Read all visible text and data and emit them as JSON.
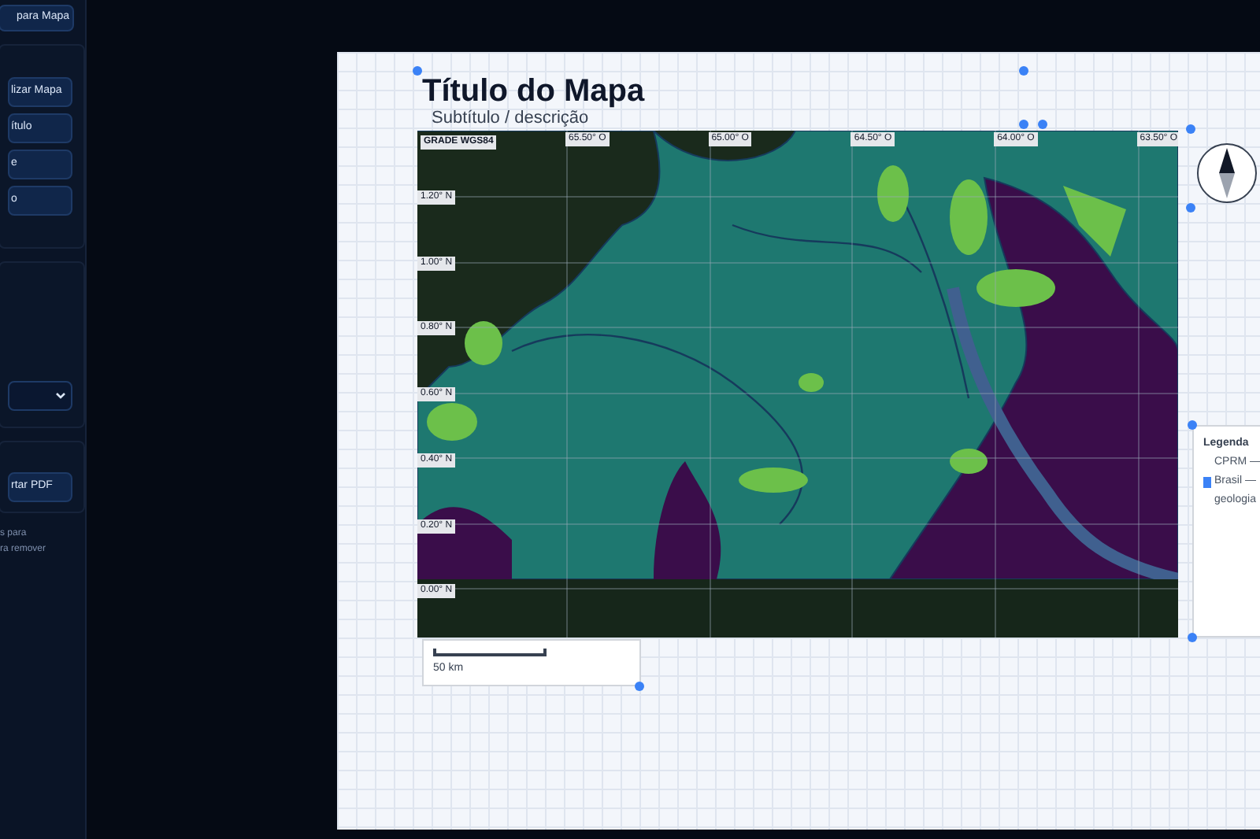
{
  "sidebar": {
    "top_button": "para Mapa",
    "action_buttons": [
      "lizar Mapa",
      "ítulo",
      "e",
      "o"
    ],
    "export_button": "rtar PDF",
    "hint_lines": [
      "s para",
      "ra remover"
    ]
  },
  "layout": {
    "title": "Título do Mapa",
    "subtitle": "Subtítulo / descrição",
    "map": {
      "grid_label": "GRADE WGS84",
      "lon_labels": [
        "65.50° O",
        "65.00° O",
        "64.50° O",
        "64.00° O",
        "63.50° O"
      ],
      "lat_labels": [
        "1.20° N",
        "1.00° N",
        "0.80° N",
        "0.60° N",
        "0.40° N",
        "0.20° N",
        "0.00° N"
      ]
    },
    "scale_bar": {
      "label": "50 km"
    },
    "legend": {
      "title": "Legenda",
      "items": [
        {
          "label": "CPRM —"
        },
        {
          "label": "Brasil —",
          "color": "#3b82f6"
        },
        {
          "label": "geologia"
        }
      ]
    }
  }
}
